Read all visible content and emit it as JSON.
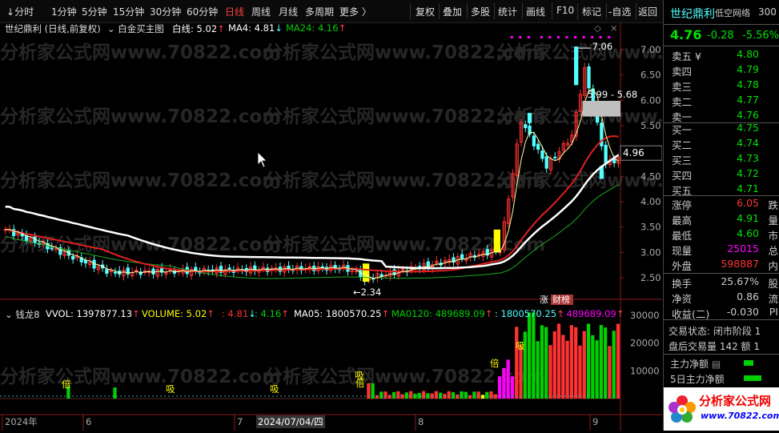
{
  "toolbar": {
    "periods": [
      {
        "label": "分时"
      },
      {
        "label": "1分钟"
      },
      {
        "label": "5分钟"
      },
      {
        "label": "15分钟"
      },
      {
        "label": "30分钟"
      },
      {
        "label": "60分钟"
      },
      {
        "label": "日线"
      },
      {
        "label": "周线"
      },
      {
        "label": "月线"
      },
      {
        "label": "多周期"
      },
      {
        "label": "更多 〉"
      }
    ],
    "active_period": "日线",
    "tools": [
      {
        "label": "复权"
      },
      {
        "label": "叠加"
      },
      {
        "label": "多股"
      },
      {
        "label": "统计"
      },
      {
        "label": "画线"
      },
      {
        "label": "F10"
      },
      {
        "label": "标记"
      },
      {
        "label": "-自选"
      },
      {
        "label": "返回"
      }
    ]
  },
  "main_chart": {
    "stock_label": "世纪鼎利 (日线,前复权)",
    "indicator_name": "白金买主图",
    "white_line_label": "白线: 5.02",
    "ma4_label": "MA4: 4.81",
    "ma24_label": "MA24: 4.16",
    "watermark": "分析家公式网www.70822.com",
    "high_label": "7.06",
    "low_label": "2.34",
    "gap_label": "5.99 - 5.68",
    "current_price_tag": "4.96",
    "y_ticks": [
      "7.00",
      "6.50",
      "6.00",
      "5.50",
      "5.00",
      "4.50",
      "4.00",
      "3.50",
      "3.00",
      "2.50"
    ],
    "markers": [
      "涨",
      "财榜"
    ]
  },
  "sub_chart": {
    "name": "钱龙8",
    "vvol": "VVOL: 1397877.13",
    "volume": "VOLUME: 5.02",
    "v2": ": 4.81",
    "v3": ": 4.16",
    "ma05": "MA05: 1800570.25",
    "ma0120": "MA0120: 489689.09",
    "v4": ": 1800570.25",
    "v5": ": 489689.09",
    "y_ticks": [
      "30000",
      "20000",
      "10000"
    ],
    "labels": [
      "倍",
      "吸",
      "吸",
      "吸",
      "倍",
      "倍",
      "吸"
    ]
  },
  "x_axis": {
    "labels": [
      "2024年",
      "6",
      "7",
      "8",
      "9"
    ],
    "cursor_date": "2024/07/04/四"
  },
  "quote": {
    "name": "世纪鼎利",
    "code": "300",
    "subtitle": "低空网络",
    "price": "4.76",
    "change": "-0.28",
    "change_pct": "-5.56%",
    "asks": [
      {
        "label": "卖五",
        "price": "4.80",
        "extra": "¥"
      },
      {
        "label": "卖四",
        "price": "4.79"
      },
      {
        "label": "卖三",
        "price": "4.78"
      },
      {
        "label": "卖二",
        "price": "4.77"
      },
      {
        "label": "卖一",
        "price": "4.76"
      }
    ],
    "bids": [
      {
        "label": "买一",
        "price": "4.75"
      },
      {
        "label": "买二",
        "price": "4.74"
      },
      {
        "label": "买三",
        "price": "4.73"
      },
      {
        "label": "买四",
        "price": "4.72"
      },
      {
        "label": "买五",
        "price": "4.71"
      }
    ],
    "stats": [
      {
        "label": "涨停",
        "value": "6.05",
        "right": "跌"
      },
      {
        "label": "最高",
        "value": "4.91",
        "right": "量"
      },
      {
        "label": "最低",
        "value": "4.60",
        "right": "市"
      },
      {
        "label": "现量",
        "value": "25015",
        "right": "总"
      },
      {
        "label": "外盘",
        "value": "598887",
        "right": "内"
      }
    ],
    "stats2": [
      {
        "label": "换手",
        "value": "25.67%",
        "right": "股"
      },
      {
        "label": "净资",
        "value": "0.86",
        "right": "流"
      },
      {
        "label": "收益(二)",
        "value": "-0.030",
        "right": "PI"
      }
    ],
    "trade_status": "交易状态: 闭市阶段 1",
    "after_hours": "盘后交易量 142 额 1",
    "main_net": "主力净额",
    "main_net_5d": "5日主力净额",
    "logo_text": "分析家公式网",
    "logo_url": "www.70822.com"
  },
  "colors": {
    "up": "#ff3232",
    "down": "#54ffff",
    "green": "#00d000",
    "yellow": "#ffff00",
    "magenta": "#ff00ff",
    "white": "#ffffff"
  }
}
